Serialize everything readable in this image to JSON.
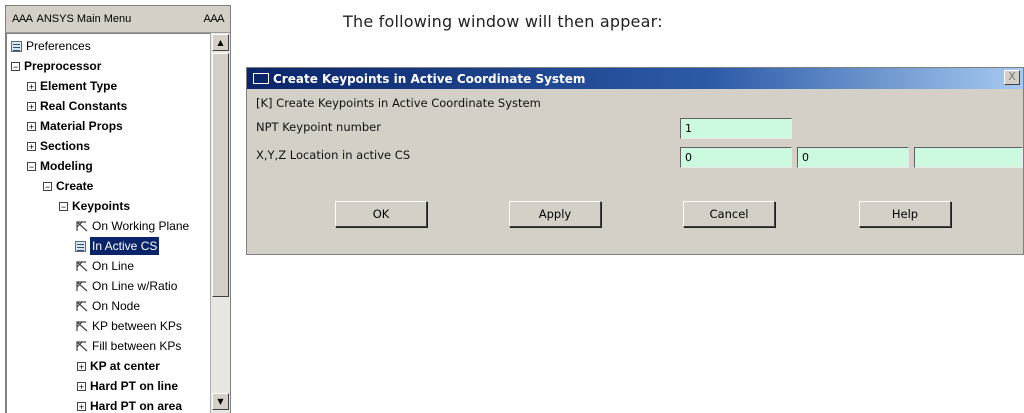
{
  "menu": {
    "title": "ANSYS Main Menu",
    "collapse_label": "AAA",
    "items": [
      {
        "label": "Preferences",
        "icon": "document-icon"
      },
      {
        "label": "Preprocessor",
        "icon": "expanded"
      },
      {
        "label": "Element Type",
        "icon": "collapsed"
      },
      {
        "label": "Real Constants",
        "icon": "collapsed"
      },
      {
        "label": "Material Props",
        "icon": "collapsed"
      },
      {
        "label": "Sections",
        "icon": "collapsed"
      },
      {
        "label": "Modeling",
        "icon": "expanded"
      },
      {
        "label": "Create",
        "icon": "expanded"
      },
      {
        "label": "Keypoints",
        "icon": "expanded"
      },
      {
        "label": "On Working Plane",
        "icon": "arrow-icon"
      },
      {
        "label": "In Active CS",
        "icon": "document-icon",
        "selected": true
      },
      {
        "label": "On Line",
        "icon": "arrow-icon"
      },
      {
        "label": "On Line w/Ratio",
        "icon": "arrow-icon"
      },
      {
        "label": "On Node",
        "icon": "arrow-icon"
      },
      {
        "label": "KP between KPs",
        "icon": "arrow-icon"
      },
      {
        "label": "Fill between KPs",
        "icon": "arrow-icon"
      },
      {
        "label": "KP at center",
        "icon": "collapsed"
      },
      {
        "label": "Hard PT on line",
        "icon": "collapsed"
      },
      {
        "label": "Hard PT on area",
        "icon": "collapsed"
      }
    ]
  },
  "caption": "The following window will then appear:",
  "dialog": {
    "title": "Create Keypoints in Active Coordinate System",
    "command": "[K]  Create Keypoints in Active Coordinate System",
    "npt_label": "NPT   Keypoint number",
    "npt_value": "1",
    "xyz_label": "X,Y,Z  Location in active CS",
    "x_value": "0",
    "y_value": "0",
    "z_value": "",
    "close_label": "X",
    "buttons": {
      "ok": "OK",
      "apply": "Apply",
      "cancel": "Cancel",
      "help": "Help"
    }
  }
}
